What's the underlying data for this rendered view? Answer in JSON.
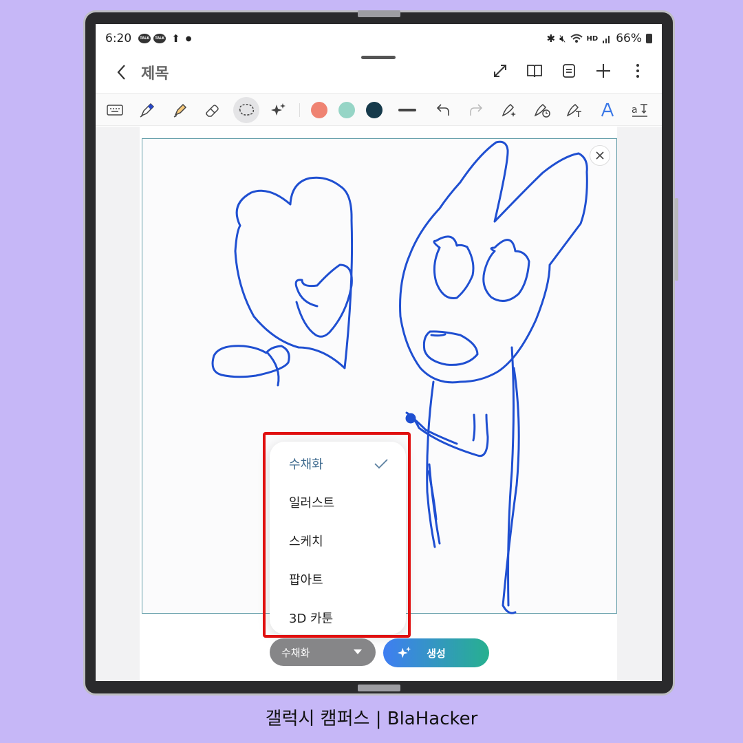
{
  "status_bar": {
    "time": "6:20",
    "talk1": "TALK",
    "talk2": "TALK",
    "battery": "66%",
    "hd": "HD"
  },
  "header": {
    "title": "제목"
  },
  "colors": {
    "coral": "#ef8372",
    "mint": "#96d5c6",
    "navy": "#163a4b",
    "ink": "#1f4fd1"
  },
  "menu": {
    "items": [
      {
        "label": "수채화",
        "selected": true
      },
      {
        "label": "일러스트",
        "selected": false
      },
      {
        "label": "스케치",
        "selected": false
      },
      {
        "label": "팝아트",
        "selected": false
      },
      {
        "label": "3D 카툰",
        "selected": false
      }
    ]
  },
  "bottom": {
    "style_label": "수채화",
    "generate_label": "생성"
  },
  "caption": "갤럭시 캠퍼스 | BlaHacker"
}
